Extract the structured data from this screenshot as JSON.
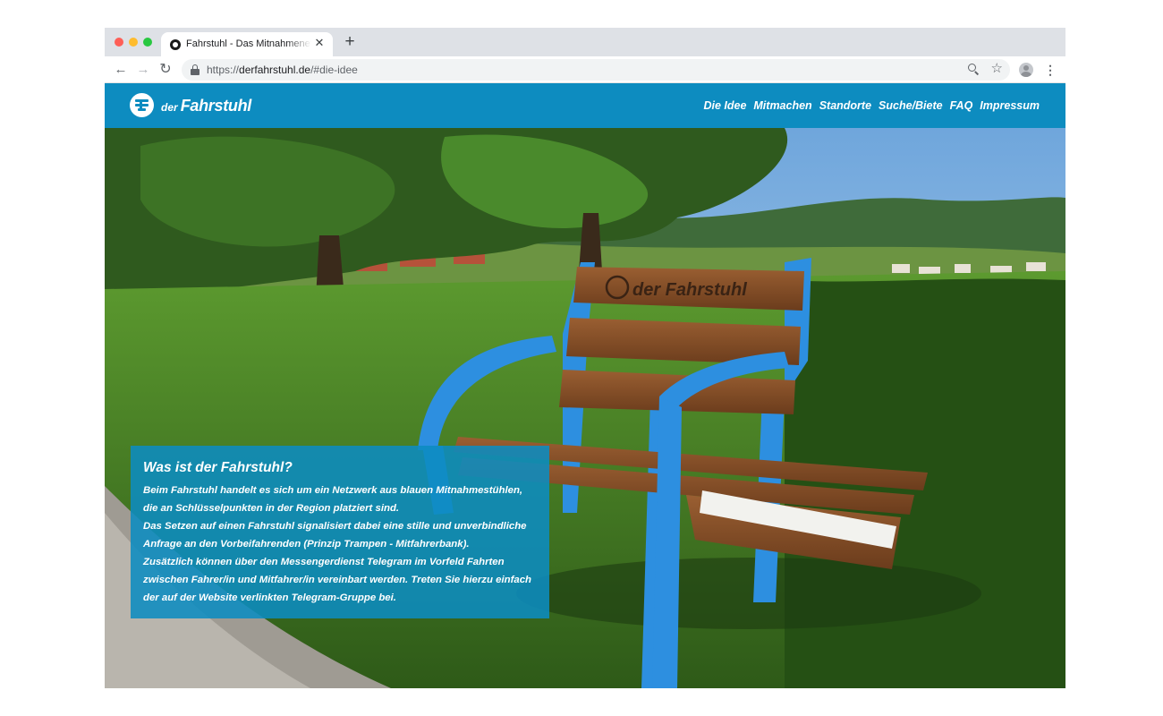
{
  "browser": {
    "tab_title": "Fahrstuhl - Das Mitnahmenetzwerk",
    "tab_close": "✕",
    "new_tab": "+",
    "url_scheme": "https://",
    "url_host": "derfahrstuhl.de",
    "url_path": "/#die-idee",
    "back_glyph": "←",
    "forward_glyph": "→",
    "reload_glyph": "↻",
    "star_glyph": "☆",
    "menu_glyph": "⋮",
    "icons": [
      "back-arrow-icon",
      "forward-arrow-icon",
      "reload-icon",
      "lock-icon",
      "zoom-icon",
      "star-icon",
      "profile-icon",
      "kebab-menu-icon"
    ]
  },
  "site": {
    "logo": {
      "small": "der",
      "big": "Fahrstuhl"
    },
    "brand_color": "#0d8cc0",
    "nav": [
      {
        "label": "Die Idee"
      },
      {
        "label": "Mitmachen"
      },
      {
        "label": "Standorte"
      },
      {
        "label": "Suche/Biete"
      },
      {
        "label": "FAQ"
      },
      {
        "label": "Impressum"
      }
    ],
    "hero": {
      "image": "photo-of-blue-bench-with-der-fahrstuhl-backrest-in-countryside",
      "bench_backrest_text": "der Fahrstuhl",
      "info": {
        "title": "Was ist der Fahrstuhl?",
        "lines": [
          "Beim Fahrstuhl handelt es sich um ein Netzwerk aus blauen Mitnahmestühlen,",
          "die an Schlüsselpunkten in der Region platziert sind.",
          "Das Setzen auf einen Fahrstuhl signalisiert dabei eine stille und unverbindliche",
          "Anfrage an den Vorbeifahrenden (Prinzip Trampen - Mitfahrerbank).",
          "Zusätzlich können über den Messengerdienst Telegram im Vorfeld Fahrten",
          "zwischen Fahrer/in und Mitfahrer/in vereinbart werden. Treten Sie hierzu einfach",
          "der auf der Website verlinkten Telegram-Gruppe bei."
        ]
      }
    }
  }
}
